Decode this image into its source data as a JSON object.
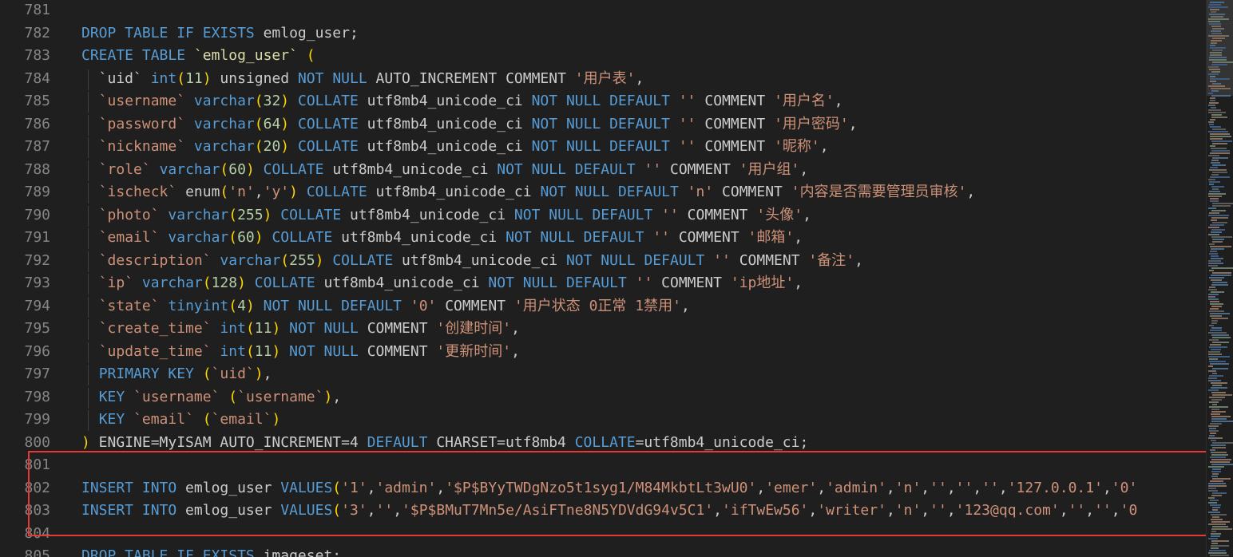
{
  "editor": {
    "lines": [
      {
        "n": "781",
        "tokens": []
      },
      {
        "n": "782",
        "tokens": [
          [
            "kw",
            "DROP TABLE IF EXISTS"
          ],
          [
            "t",
            " emlog_user;"
          ]
        ]
      },
      {
        "n": "783",
        "tokens": [
          [
            "kw",
            "CREATE TABLE"
          ],
          [
            "t",
            " "
          ],
          [
            "fn",
            "`emlog_user`"
          ],
          [
            "t",
            " "
          ],
          [
            "br",
            "("
          ]
        ]
      },
      {
        "n": "784",
        "tokens": [
          [
            "t",
            "  `uid` "
          ],
          [
            "kw",
            "int"
          ],
          [
            "br",
            "("
          ],
          [
            "num",
            "11"
          ],
          [
            "br",
            ")"
          ],
          [
            "t",
            " unsigned "
          ],
          [
            "kw",
            "NOT NULL"
          ],
          [
            "t",
            " AUTO_INCREMENT COMMENT "
          ],
          [
            "str",
            "'用户表'"
          ],
          [
            "t",
            ","
          ]
        ]
      },
      {
        "n": "785",
        "tokens": [
          [
            "t",
            "  "
          ],
          [
            "str",
            "`username`"
          ],
          [
            "t",
            " "
          ],
          [
            "kw",
            "varchar"
          ],
          [
            "br",
            "("
          ],
          [
            "num",
            "32"
          ],
          [
            "br",
            ")"
          ],
          [
            "t",
            " "
          ],
          [
            "kw",
            "COLLATE"
          ],
          [
            "t",
            " utf8mb4_unicode_ci "
          ],
          [
            "kw",
            "NOT NULL DEFAULT"
          ],
          [
            "t",
            " "
          ],
          [
            "str",
            "''"
          ],
          [
            "t",
            " COMMENT "
          ],
          [
            "str",
            "'用户名'"
          ],
          [
            "t",
            ","
          ]
        ]
      },
      {
        "n": "786",
        "tokens": [
          [
            "t",
            "  "
          ],
          [
            "str",
            "`password`"
          ],
          [
            "t",
            " "
          ],
          [
            "kw",
            "varchar"
          ],
          [
            "br",
            "("
          ],
          [
            "num",
            "64"
          ],
          [
            "br",
            ")"
          ],
          [
            "t",
            " "
          ],
          [
            "kw",
            "COLLATE"
          ],
          [
            "t",
            " utf8mb4_unicode_ci "
          ],
          [
            "kw",
            "NOT NULL DEFAULT"
          ],
          [
            "t",
            " "
          ],
          [
            "str",
            "''"
          ],
          [
            "t",
            " COMMENT "
          ],
          [
            "str",
            "'用户密码'"
          ],
          [
            "t",
            ","
          ]
        ]
      },
      {
        "n": "787",
        "tokens": [
          [
            "t",
            "  "
          ],
          [
            "str",
            "`nickname`"
          ],
          [
            "t",
            " "
          ],
          [
            "kw",
            "varchar"
          ],
          [
            "br",
            "("
          ],
          [
            "num",
            "20"
          ],
          [
            "br",
            ")"
          ],
          [
            "t",
            " "
          ],
          [
            "kw",
            "COLLATE"
          ],
          [
            "t",
            " utf8mb4_unicode_ci "
          ],
          [
            "kw",
            "NOT NULL DEFAULT"
          ],
          [
            "t",
            " "
          ],
          [
            "str",
            "''"
          ],
          [
            "t",
            " COMMENT "
          ],
          [
            "str",
            "'昵称'"
          ],
          [
            "t",
            ","
          ]
        ]
      },
      {
        "n": "788",
        "tokens": [
          [
            "t",
            "  "
          ],
          [
            "str",
            "`role`"
          ],
          [
            "t",
            " "
          ],
          [
            "kw",
            "varchar"
          ],
          [
            "br",
            "("
          ],
          [
            "num",
            "60"
          ],
          [
            "br",
            ")"
          ],
          [
            "t",
            " "
          ],
          [
            "kw",
            "COLLATE"
          ],
          [
            "t",
            " utf8mb4_unicode_ci "
          ],
          [
            "kw",
            "NOT NULL DEFAULT"
          ],
          [
            "t",
            " "
          ],
          [
            "str",
            "''"
          ],
          [
            "t",
            " COMMENT "
          ],
          [
            "str",
            "'用户组'"
          ],
          [
            "t",
            ","
          ]
        ]
      },
      {
        "n": "789",
        "tokens": [
          [
            "t",
            "  "
          ],
          [
            "str",
            "`ischeck`"
          ],
          [
            "t",
            " enum"
          ],
          [
            "br",
            "("
          ],
          [
            "str",
            "'n'"
          ],
          [
            "t",
            ","
          ],
          [
            "str",
            "'y'"
          ],
          [
            "br",
            ")"
          ],
          [
            "t",
            " "
          ],
          [
            "kw",
            "COLLATE"
          ],
          [
            "t",
            " utf8mb4_unicode_ci "
          ],
          [
            "kw",
            "NOT NULL DEFAULT"
          ],
          [
            "t",
            " "
          ],
          [
            "str",
            "'n'"
          ],
          [
            "t",
            " COMMENT "
          ],
          [
            "str",
            "'内容是否需要管理员审核'"
          ],
          [
            "t",
            ","
          ]
        ]
      },
      {
        "n": "790",
        "tokens": [
          [
            "t",
            "  "
          ],
          [
            "str",
            "`photo`"
          ],
          [
            "t",
            " "
          ],
          [
            "kw",
            "varchar"
          ],
          [
            "br",
            "("
          ],
          [
            "num",
            "255"
          ],
          [
            "br",
            ")"
          ],
          [
            "t",
            " "
          ],
          [
            "kw",
            "COLLATE"
          ],
          [
            "t",
            " utf8mb4_unicode_ci "
          ],
          [
            "kw",
            "NOT NULL DEFAULT"
          ],
          [
            "t",
            " "
          ],
          [
            "str",
            "''"
          ],
          [
            "t",
            " COMMENT "
          ],
          [
            "str",
            "'头像'"
          ],
          [
            "t",
            ","
          ]
        ]
      },
      {
        "n": "791",
        "tokens": [
          [
            "t",
            "  "
          ],
          [
            "str",
            "`email`"
          ],
          [
            "t",
            " "
          ],
          [
            "kw",
            "varchar"
          ],
          [
            "br",
            "("
          ],
          [
            "num",
            "60"
          ],
          [
            "br",
            ")"
          ],
          [
            "t",
            " "
          ],
          [
            "kw",
            "COLLATE"
          ],
          [
            "t",
            " utf8mb4_unicode_ci "
          ],
          [
            "kw",
            "NOT NULL DEFAULT"
          ],
          [
            "t",
            " "
          ],
          [
            "str",
            "''"
          ],
          [
            "t",
            " COMMENT "
          ],
          [
            "str",
            "'邮箱'"
          ],
          [
            "t",
            ","
          ]
        ]
      },
      {
        "n": "792",
        "tokens": [
          [
            "t",
            "  "
          ],
          [
            "str",
            "`description`"
          ],
          [
            "t",
            " "
          ],
          [
            "kw",
            "varchar"
          ],
          [
            "br",
            "("
          ],
          [
            "num",
            "255"
          ],
          [
            "br",
            ")"
          ],
          [
            "t",
            " "
          ],
          [
            "kw",
            "COLLATE"
          ],
          [
            "t",
            " utf8mb4_unicode_ci "
          ],
          [
            "kw",
            "NOT NULL DEFAULT"
          ],
          [
            "t",
            " "
          ],
          [
            "str",
            "''"
          ],
          [
            "t",
            " COMMENT "
          ],
          [
            "str",
            "'备注'"
          ],
          [
            "t",
            ","
          ]
        ]
      },
      {
        "n": "793",
        "tokens": [
          [
            "t",
            "  "
          ],
          [
            "str",
            "`ip`"
          ],
          [
            "t",
            " "
          ],
          [
            "kw",
            "varchar"
          ],
          [
            "br",
            "("
          ],
          [
            "num",
            "128"
          ],
          [
            "br",
            ")"
          ],
          [
            "t",
            " "
          ],
          [
            "kw",
            "COLLATE"
          ],
          [
            "t",
            " utf8mb4_unicode_ci "
          ],
          [
            "kw",
            "NOT NULL DEFAULT"
          ],
          [
            "t",
            " "
          ],
          [
            "str",
            "''"
          ],
          [
            "t",
            " COMMENT "
          ],
          [
            "str",
            "'ip地址'"
          ],
          [
            "t",
            ","
          ]
        ]
      },
      {
        "n": "794",
        "tokens": [
          [
            "t",
            "  "
          ],
          [
            "str",
            "`state`"
          ],
          [
            "t",
            " "
          ],
          [
            "kw",
            "tinyint"
          ],
          [
            "br",
            "("
          ],
          [
            "num",
            "4"
          ],
          [
            "br",
            ")"
          ],
          [
            "t",
            " "
          ],
          [
            "kw",
            "NOT NULL DEFAULT"
          ],
          [
            "t",
            " "
          ],
          [
            "str",
            "'0'"
          ],
          [
            "t",
            " COMMENT "
          ],
          [
            "str",
            "'用户状态 0正常 1禁用'"
          ],
          [
            "t",
            ","
          ]
        ]
      },
      {
        "n": "795",
        "tokens": [
          [
            "t",
            "  "
          ],
          [
            "str",
            "`create_time`"
          ],
          [
            "t",
            " "
          ],
          [
            "kw",
            "int"
          ],
          [
            "br",
            "("
          ],
          [
            "num",
            "11"
          ],
          [
            "br",
            ")"
          ],
          [
            "t",
            " "
          ],
          [
            "kw",
            "NOT NULL"
          ],
          [
            "t",
            " COMMENT "
          ],
          [
            "str",
            "'创建时间'"
          ],
          [
            "t",
            ","
          ]
        ]
      },
      {
        "n": "796",
        "tokens": [
          [
            "t",
            "  "
          ],
          [
            "str",
            "`update_time`"
          ],
          [
            "t",
            " "
          ],
          [
            "kw",
            "int"
          ],
          [
            "br",
            "("
          ],
          [
            "num",
            "11"
          ],
          [
            "br",
            ")"
          ],
          [
            "t",
            " "
          ],
          [
            "kw",
            "NOT NULL"
          ],
          [
            "t",
            " COMMENT "
          ],
          [
            "str",
            "'更新时间'"
          ],
          [
            "t",
            ","
          ]
        ]
      },
      {
        "n": "797",
        "tokens": [
          [
            "t",
            "  "
          ],
          [
            "kw",
            "PRIMARY KEY"
          ],
          [
            "t",
            " "
          ],
          [
            "br",
            "("
          ],
          [
            "str",
            "`uid`"
          ],
          [
            "br",
            ")"
          ],
          [
            "t",
            ","
          ]
        ]
      },
      {
        "n": "798",
        "tokens": [
          [
            "t",
            "  "
          ],
          [
            "kw",
            "KEY"
          ],
          [
            "t",
            " "
          ],
          [
            "str",
            "`username`"
          ],
          [
            "t",
            " "
          ],
          [
            "br",
            "("
          ],
          [
            "str",
            "`username`"
          ],
          [
            "br",
            ")"
          ],
          [
            "t",
            ","
          ]
        ]
      },
      {
        "n": "799",
        "tokens": [
          [
            "t",
            "  "
          ],
          [
            "kw",
            "KEY"
          ],
          [
            "t",
            " "
          ],
          [
            "str",
            "`email`"
          ],
          [
            "t",
            " "
          ],
          [
            "br",
            "("
          ],
          [
            "str",
            "`email`"
          ],
          [
            "br",
            ")"
          ]
        ]
      },
      {
        "n": "800",
        "tokens": [
          [
            "br",
            ")"
          ],
          [
            "t",
            " ENGINE=MyISAM AUTO_INCREMENT=4 "
          ],
          [
            "kw",
            "DEFAULT"
          ],
          [
            "t",
            " CHARSET=utf8mb4 "
          ],
          [
            "kw",
            "COLLATE"
          ],
          [
            "t",
            "=utf8mb4_unicode_ci;"
          ]
        ]
      },
      {
        "n": "801",
        "tokens": []
      },
      {
        "n": "802",
        "tokens": [
          [
            "kw",
            "INSERT INTO"
          ],
          [
            "t",
            " emlog_user "
          ],
          [
            "kw",
            "VALUES"
          ],
          [
            "br",
            "("
          ],
          [
            "str",
            "'1'"
          ],
          [
            "t",
            ","
          ],
          [
            "str",
            "'admin'"
          ],
          [
            "t",
            ","
          ],
          [
            "str",
            "'$P$BYyTWDgNzo5t1syg1/M84MkbtLt3wU0'"
          ],
          [
            "t",
            ","
          ],
          [
            "str",
            "'emer'"
          ],
          [
            "t",
            ","
          ],
          [
            "str",
            "'admin'"
          ],
          [
            "t",
            ","
          ],
          [
            "str",
            "'n'"
          ],
          [
            "t",
            ","
          ],
          [
            "str",
            "''"
          ],
          [
            "t",
            ","
          ],
          [
            "str",
            "''"
          ],
          [
            "t",
            ","
          ],
          [
            "str",
            "''"
          ],
          [
            "t",
            ","
          ],
          [
            "str",
            "'127.0.0.1'"
          ],
          [
            "t",
            ","
          ],
          [
            "str",
            "'0'"
          ]
        ]
      },
      {
        "n": "803",
        "tokens": [
          [
            "kw",
            "INSERT INTO"
          ],
          [
            "t",
            " emlog_user "
          ],
          [
            "kw",
            "VALUES"
          ],
          [
            "br",
            "("
          ],
          [
            "str",
            "'3'"
          ],
          [
            "t",
            ","
          ],
          [
            "str",
            "''"
          ],
          [
            "t",
            ","
          ],
          [
            "str",
            "'$P$BMuT7Mn5e/AsiFTne8N5YDVdG94v5C1'"
          ],
          [
            "t",
            ","
          ],
          [
            "str",
            "'ifTwEw56'"
          ],
          [
            "t",
            ","
          ],
          [
            "str",
            "'writer'"
          ],
          [
            "t",
            ","
          ],
          [
            "str",
            "'n'"
          ],
          [
            "t",
            ","
          ],
          [
            "str",
            "''"
          ],
          [
            "t",
            ","
          ],
          [
            "str",
            "'123@qq.com'"
          ],
          [
            "t",
            ","
          ],
          [
            "str",
            "''"
          ],
          [
            "t",
            ","
          ],
          [
            "str",
            "''"
          ],
          [
            "t",
            ","
          ],
          [
            "str",
            "'0"
          ]
        ]
      },
      {
        "n": "804",
        "tokens": []
      },
      {
        "n": "805",
        "tokens": [
          [
            "kw",
            "DROP TABLE IF EXISTS"
          ],
          [
            "t",
            " imageset;"
          ]
        ]
      }
    ]
  },
  "colors": {
    "background": "#1f1f1f",
    "keyword": "#569cd6",
    "string": "#ce9178",
    "number": "#b5cea8",
    "bracket": "#ffd700",
    "highlight_box": "#e53935"
  }
}
